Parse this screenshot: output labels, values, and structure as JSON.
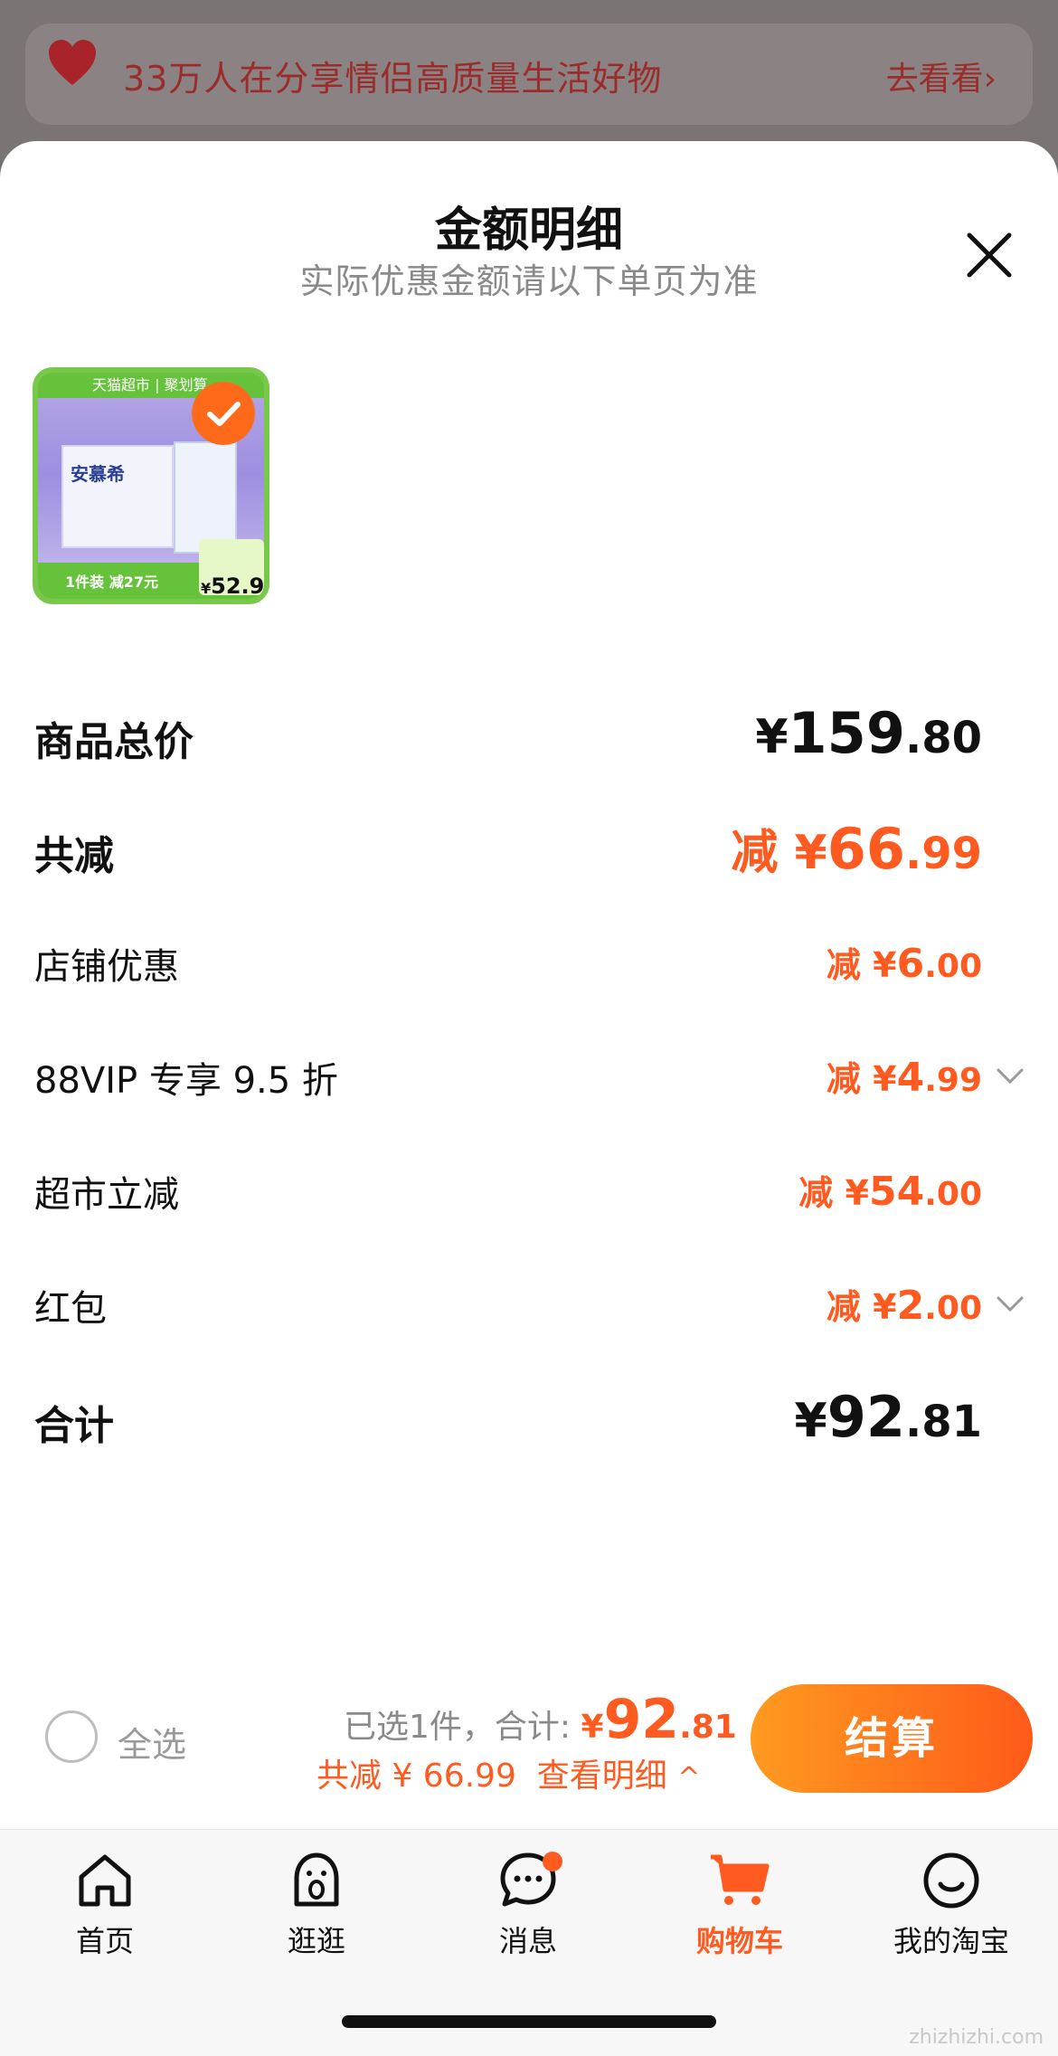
{
  "banner": {
    "text": "33万人在分享情侣高质量生活好物",
    "link_label": "去看看",
    "link_arrow": "›"
  },
  "sheet": {
    "title": "金额明细",
    "subtitle": "实际优惠金额请以下单页为准",
    "close_icon": "close-icon"
  },
  "product": {
    "badge_top": "天猫超市 | 聚划算",
    "brand": "安慕希",
    "bottom_text": "1件装 减27元",
    "price_yen": "¥",
    "price": "52.9"
  },
  "rows": [
    {
      "label": "商品总价",
      "prefix": "",
      "yen": "¥",
      "int": "159",
      "dec": ".80",
      "style": "big-black",
      "chevron": false
    },
    {
      "label": "共减",
      "prefix": "减 ",
      "yen": "¥",
      "int": "66",
      "dec": ".99",
      "style": "big-orange",
      "chevron": false
    },
    {
      "label": "店铺优惠",
      "prefix": "减 ",
      "yen": "¥",
      "int": "6",
      "dec": ".00",
      "style": "orange",
      "chevron": false
    },
    {
      "label": "88VIP 专享 9.5 折",
      "prefix": "减 ",
      "yen": "¥",
      "int": "4",
      "dec": ".99",
      "style": "orange",
      "chevron": true
    },
    {
      "label": "超市立减",
      "prefix": "减 ",
      "yen": "¥",
      "int": "54",
      "dec": ".00",
      "style": "orange",
      "chevron": false
    },
    {
      "label": "红包",
      "prefix": "减 ",
      "yen": "¥",
      "int": "2",
      "dec": ".00",
      "style": "orange",
      "chevron": true
    },
    {
      "label": "合计",
      "prefix": "",
      "yen": "¥",
      "int": "92",
      "dec": ".81",
      "style": "big-black",
      "chevron": false
    }
  ],
  "footer": {
    "select_all": "全选",
    "selected_text": "已选1件，合计:",
    "total_yen": "¥",
    "total_int": "92",
    "total_dec": ".81",
    "saving_text": "共减 ¥ 66.99",
    "detail_link": "查看明细",
    "detail_arrow": "^",
    "checkout": "结算"
  },
  "tabs": [
    {
      "label": "首页",
      "icon": "home-icon",
      "active": false
    },
    {
      "label": "逛逛",
      "icon": "stroll-icon",
      "active": false
    },
    {
      "label": "消息",
      "icon": "message-icon",
      "active": false,
      "badge": true
    },
    {
      "label": "购物车",
      "icon": "cart-icon",
      "active": true
    },
    {
      "label": "我的淘宝",
      "icon": "profile-icon",
      "active": false
    }
  ],
  "watermark": "zhizhizhi.com",
  "colors": {
    "accent": "#ff5a1f",
    "checkout_start": "#ff9a1f",
    "checkout_end": "#ff5a1a"
  }
}
